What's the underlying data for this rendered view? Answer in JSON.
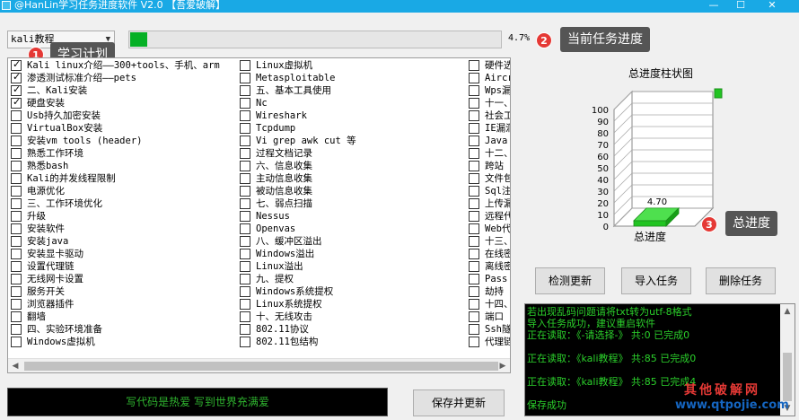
{
  "window": {
    "title": "@HanLin学习任务进度软件 V2.0 【吾爱破解】",
    "minimize": "—",
    "maximize": "☐",
    "close": "✕"
  },
  "plan": {
    "selected": "kali教程"
  },
  "progress": {
    "percent_label": "4.7%",
    "value": 4.7
  },
  "callouts": [
    {
      "num": "1",
      "text": "学习计划"
    },
    {
      "num": "2",
      "text": "当前任务进度"
    },
    {
      "num": "3",
      "text": "总进度"
    }
  ],
  "tasks": {
    "col1": [
      {
        "label": "Kali linux介绍——300+tools、手机、arm",
        "checked": true
      },
      {
        "label": "渗透测试标准介绍——pets",
        "checked": true
      },
      {
        "label": "二、Kali安装",
        "checked": true
      },
      {
        "label": "硬盘安装",
        "checked": true
      },
      {
        "label": "Usb持久加密安装",
        "checked": false
      },
      {
        "label": "VirtualBox安装",
        "checked": false
      },
      {
        "label": "安装vm tools (header)",
        "checked": false
      },
      {
        "label": "熟悉工作环境",
        "checked": false
      },
      {
        "label": "熟悉bash",
        "checked": false
      },
      {
        "label": "Kali的并发线程限制",
        "checked": false
      },
      {
        "label": "电源优化",
        "checked": false
      },
      {
        "label": "三、工作环境优化",
        "checked": false
      },
      {
        "label": "升级",
        "checked": false
      },
      {
        "label": "安装软件",
        "checked": false
      },
      {
        "label": "安装java",
        "checked": false
      },
      {
        "label": "安装显卡驱动",
        "checked": false
      },
      {
        "label": "设置代理链",
        "checked": false
      },
      {
        "label": "无线网卡设置",
        "checked": false
      },
      {
        "label": "服务开关",
        "checked": false
      },
      {
        "label": "浏览器插件",
        "checked": false
      },
      {
        "label": "翻墙",
        "checked": false
      },
      {
        "label": "四、实验环境准备",
        "checked": false
      },
      {
        "label": "Windows虚拟机",
        "checked": false
      }
    ],
    "col2": [
      {
        "label": "Linux虚拟机",
        "checked": false
      },
      {
        "label": "Metasploitable",
        "checked": false
      },
      {
        "label": "五、基本工具使用",
        "checked": false
      },
      {
        "label": "Nc",
        "checked": false
      },
      {
        "label": "Wireshark",
        "checked": false
      },
      {
        "label": "Tcpdump",
        "checked": false
      },
      {
        "label": "Vi grep awk cut 等",
        "checked": false
      },
      {
        "label": "过程文档记录",
        "checked": false
      },
      {
        "label": "六、信息收集",
        "checked": false
      },
      {
        "label": "主动信息收集",
        "checked": false
      },
      {
        "label": "被动信息收集",
        "checked": false
      },
      {
        "label": "七、弱点扫描",
        "checked": false
      },
      {
        "label": "Nessus",
        "checked": false
      },
      {
        "label": "Openvas",
        "checked": false
      },
      {
        "label": "八、缓冲区溢出",
        "checked": false
      },
      {
        "label": "Windows溢出",
        "checked": false
      },
      {
        "label": "Linux溢出",
        "checked": false
      },
      {
        "label": "九、提权",
        "checked": false
      },
      {
        "label": "Windows系统提权",
        "checked": false
      },
      {
        "label": "Linux系统提权",
        "checked": false
      },
      {
        "label": "十、无线攻击",
        "checked": false
      },
      {
        "label": "802.11协议",
        "checked": false
      },
      {
        "label": "802.11包结构",
        "checked": false
      }
    ],
    "col3": [
      {
        "label": "硬件选",
        "checked": false
      },
      {
        "label": "Aircr",
        "checked": false
      },
      {
        "label": "Wps漏",
        "checked": false
      },
      {
        "label": "十一、",
        "checked": false
      },
      {
        "label": "社会工",
        "checked": false
      },
      {
        "label": "IE漏洞",
        "checked": false
      },
      {
        "label": "Java",
        "checked": false
      },
      {
        "label": "十二、",
        "checked": false
      },
      {
        "label": "跨站",
        "checked": false
      },
      {
        "label": "文件包",
        "checked": false
      },
      {
        "label": "Sql注",
        "checked": false
      },
      {
        "label": "上传漏",
        "checked": false
      },
      {
        "label": "远程代",
        "checked": false
      },
      {
        "label": "Web代",
        "checked": false
      },
      {
        "label": "十三、",
        "checked": false
      },
      {
        "label": "在线密",
        "checked": false
      },
      {
        "label": "离线密",
        "checked": false
      },
      {
        "label": "Pass",
        "checked": false
      },
      {
        "label": "劫持",
        "checked": false
      },
      {
        "label": "十四、",
        "checked": false
      },
      {
        "label": "端口",
        "checked": false
      },
      {
        "label": "Ssh隧",
        "checked": false
      },
      {
        "label": "代理链",
        "checked": false
      }
    ]
  },
  "chart_data": {
    "type": "bar",
    "title": "总进度柱状图",
    "categories": [
      "总进度"
    ],
    "values": [
      4.7
    ],
    "data_labels": [
      "4.70"
    ],
    "yticks": [
      "100",
      "90",
      "80",
      "70",
      "60",
      "50",
      "40",
      "30",
      "20",
      "10",
      "0"
    ],
    "ylim": [
      0,
      100
    ],
    "legend": "top-right",
    "bar_color": "#22c422"
  },
  "buttons": {
    "check_update": "检测更新",
    "import": "导入任务",
    "delete": "删除任务",
    "save_refresh": "保存并更新"
  },
  "log": [
    "若出现乱码问题请将txt转为utf-8格式",
    "导入任务成功，建议重启软件",
    "正在读取：《-请选择-》 共:0 已完成0",
    "",
    "正在读取：《kali教程》 共:85 已完成0",
    "",
    "正在读取：《kali教程》 共:85 已完成4",
    "",
    "保存成功"
  ],
  "slogan": "写代码是热爱 写到世界充满爱",
  "watermark": {
    "line1": "其他破解网",
    "line2": "www.qtpojie.com"
  }
}
